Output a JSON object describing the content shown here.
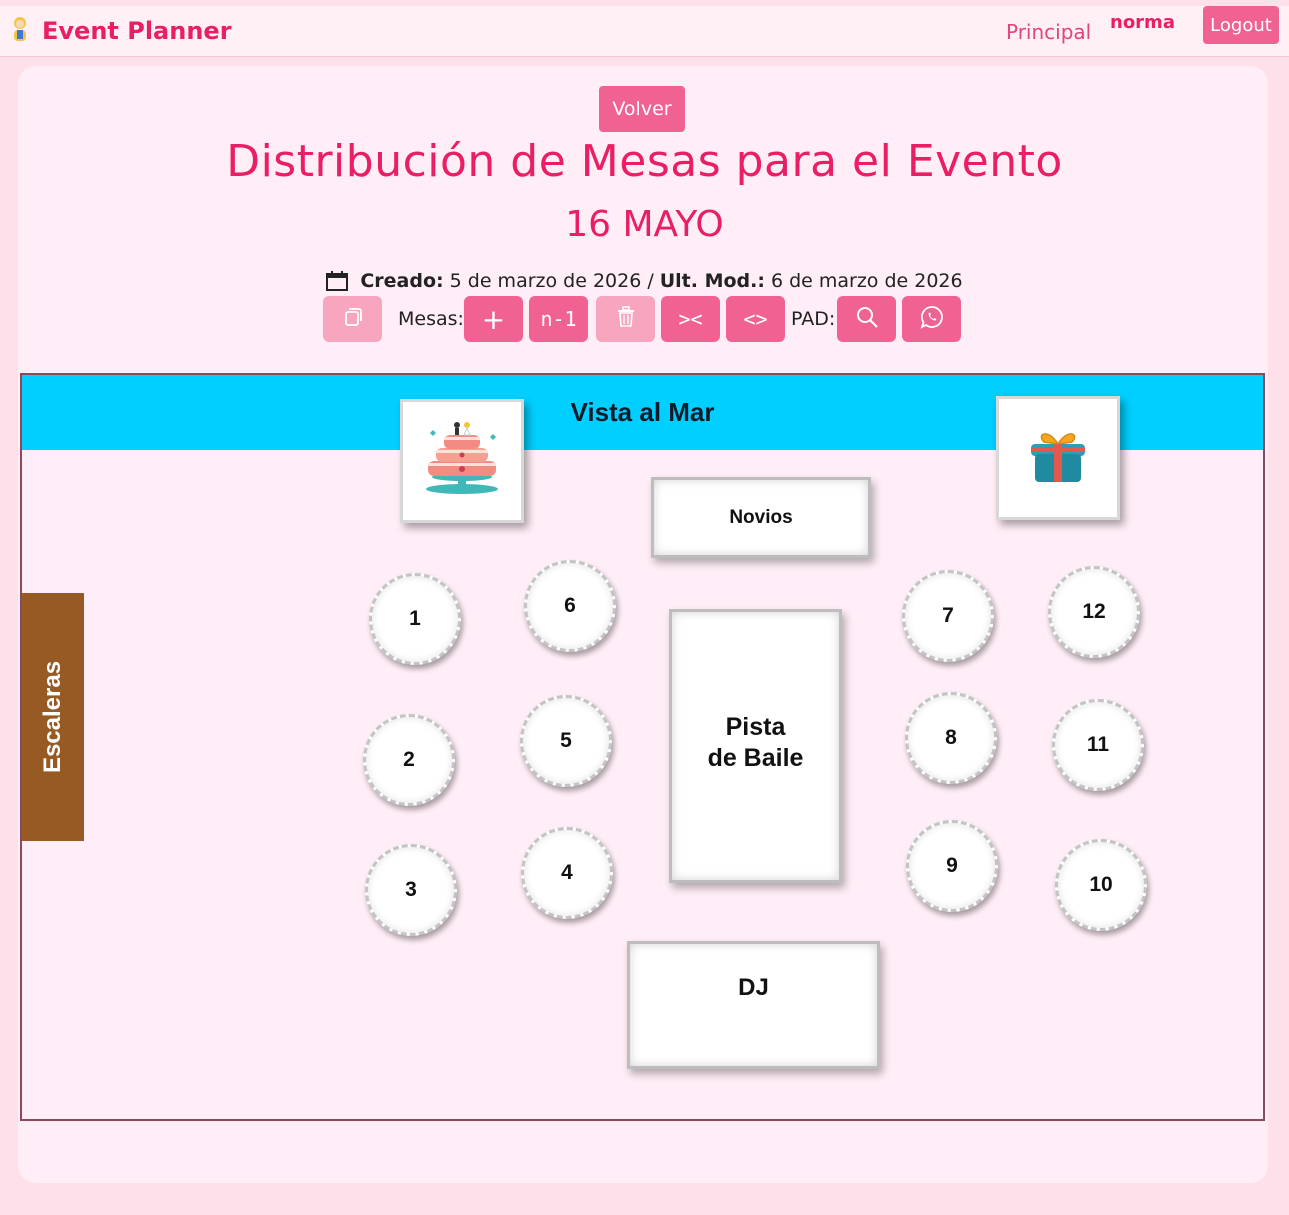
{
  "header": {
    "brand_icon": "person-icon",
    "brand_title": "Event Planner",
    "nav_principal": "Principal",
    "user_name": "norma",
    "logout_label": "Logout"
  },
  "page": {
    "back_label": "Volver",
    "title": "Distribución de Mesas para el Evento",
    "event_name": "16 MAYO",
    "meta": {
      "created_label": "Creado:",
      "created_value": "5 de marzo de 2026",
      "separator": "/",
      "modified_label": "Ult. Mod.:",
      "modified_value": "6 de marzo de 2026"
    }
  },
  "toolbar": {
    "mesas_label": "Mesas:",
    "pad_label": "PAD:",
    "add_label": "+",
    "n_minus_label": "n-1",
    "shrink_label": "><",
    "expand_label": "<>"
  },
  "plan": {
    "sea_label": "Vista al Mar",
    "stairs_label": "Escaleras",
    "cake_icon": "wedding-cake-icon",
    "gift_icon": "gift-icon",
    "novios_label": "Novios",
    "dance_line1": "Pista",
    "dance_line2": "de Baile",
    "dj_label": "DJ",
    "tables": [
      "1",
      "2",
      "3",
      "4",
      "5",
      "6",
      "7",
      "8",
      "9",
      "10",
      "11",
      "12"
    ]
  },
  "colors": {
    "accent": "#e91e63",
    "button": "#f06292",
    "button_dim": "#f8a5c0",
    "sea": "#00cfff",
    "stairs": "#965a22",
    "background": "#fde0ea",
    "card": "#ffeef7"
  }
}
